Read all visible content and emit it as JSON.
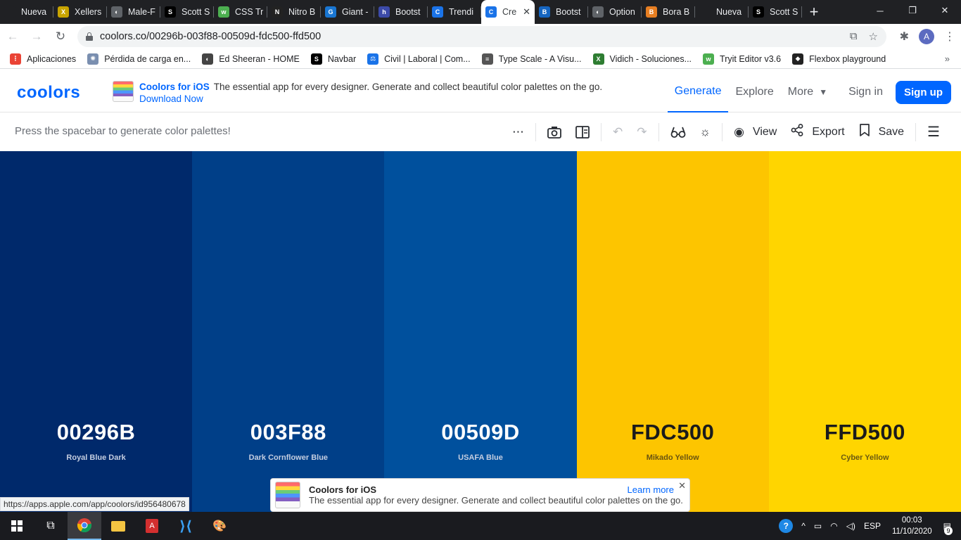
{
  "browser": {
    "tabs": [
      {
        "label": "Nueva pest",
        "color": "#202124",
        "glyph": ""
      },
      {
        "label": "Xellers",
        "color": "#c8a400",
        "glyph": "X"
      },
      {
        "label": "Male-F",
        "color": "#5f6368",
        "glyph": "◐"
      },
      {
        "label": "Scott S",
        "color": "#000000",
        "glyph": "S"
      },
      {
        "label": "CSS Tr",
        "color": "#4caf50",
        "glyph": "w"
      },
      {
        "label": "Nitro B",
        "color": "#222222",
        "glyph": "N"
      },
      {
        "label": "Giant -",
        "color": "#1976d2",
        "glyph": "G"
      },
      {
        "label": "Bootst",
        "color": "#3c4aa8",
        "glyph": "h"
      },
      {
        "label": "Trendi",
        "color": "#1a73e8",
        "glyph": "C"
      },
      {
        "label": "Cre",
        "color": "#1a73e8",
        "glyph": "C",
        "active": true
      },
      {
        "label": "Bootst",
        "color": "#1565c0",
        "glyph": "B"
      },
      {
        "label": "Option",
        "color": "#5f6368",
        "glyph": "◐"
      },
      {
        "label": "Bora B",
        "color": "#e67e22",
        "glyph": "B"
      },
      {
        "label": "Nueva pest",
        "color": "#202124",
        "glyph": ""
      },
      {
        "label": "Scott S",
        "color": "#000000",
        "glyph": "S"
      }
    ],
    "url": "coolors.co/00296b-003f88-00509d-fdc500-ffd500",
    "profile_initial": "A",
    "bookmarks": [
      {
        "label": "Aplicaciones",
        "color": "#ea4335",
        "glyph": "⋮"
      },
      {
        "label": "Pérdida de carga en...",
        "color": "#7a8fb0",
        "glyph": "✺"
      },
      {
        "label": "Ed Sheeran - HOME",
        "color": "#444444",
        "glyph": "◐"
      },
      {
        "label": "Navbar",
        "color": "#000000",
        "glyph": "S"
      },
      {
        "label": "Civil | Laboral | Com...",
        "color": "#1a73e8",
        "glyph": "⚖"
      },
      {
        "label": "Type Scale - A Visu...",
        "color": "#555555",
        "glyph": "≡"
      },
      {
        "label": "Vidich - Soluciones...",
        "color": "#2e7d32",
        "glyph": "X"
      },
      {
        "label": "Tryit Editor v3.6",
        "color": "#4caf50",
        "glyph": "w"
      },
      {
        "label": "Flexbox playground",
        "color": "#222222",
        "glyph": "◆"
      }
    ]
  },
  "site": {
    "logo": "coolors",
    "promo_title": "Coolors for iOS",
    "promo_desc": "The essential app for every designer. Generate and collect beautiful color palettes on the go.",
    "promo_link": "Download Now",
    "nav": {
      "generate": "Generate",
      "explore": "Explore",
      "more": "More",
      "sign_in": "Sign in",
      "sign_up": "Sign up"
    },
    "hint": "Press the spacebar to generate color palettes!",
    "tools": {
      "view": "View",
      "export": "Export",
      "save": "Save"
    }
  },
  "palette": [
    {
      "hex": "00296B",
      "name": "Royal Blue Dark",
      "color": "#00296b",
      "text_color": "#ffffff",
      "name_color": "#c4cde0"
    },
    {
      "hex": "003F88",
      "name": "Dark Cornflower Blue",
      "color": "#003f88",
      "text_color": "#ffffff",
      "name_color": "#c4cde0"
    },
    {
      "hex": "00509D",
      "name": "USAFA Blue",
      "color": "#00509d",
      "text_color": "#ffffff",
      "name_color": "#c4cde0"
    },
    {
      "hex": "FDC500",
      "name": "Mikado Yellow",
      "color": "#fdc500",
      "text_color": "#1b1b1b",
      "name_color": "#6a5410"
    },
    {
      "hex": "FFD500",
      "name": "Cyber Yellow",
      "color": "#ffd500",
      "text_color": "#1b1b1b",
      "name_color": "#6a5a10"
    }
  ],
  "popup": {
    "title": "Coolors for iOS",
    "desc": "The essential app for every designer. Generate and collect beautiful color palettes on the go.",
    "learn_more": "Learn more"
  },
  "status_url": "https://apps.apple.com/app/coolors/id956480678",
  "taskbar": {
    "language": "ESP",
    "time": "00:03",
    "date": "11/10/2020",
    "notifications": "9"
  }
}
